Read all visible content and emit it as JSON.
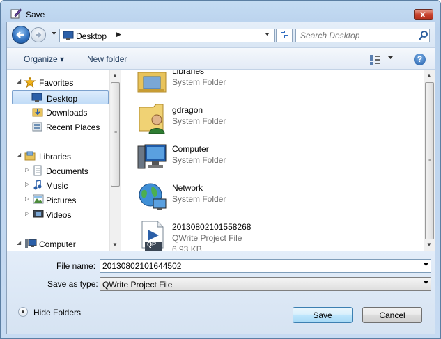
{
  "window": {
    "title": "Save",
    "close_glyph": "x"
  },
  "nav": {
    "address": "Desktop",
    "address_arrow": "▶",
    "search_placeholder": "Search Desktop"
  },
  "toolbar": {
    "organize": "Organize ▾",
    "new_folder": "New folder"
  },
  "tree": {
    "favorites": "Favorites",
    "desktop": "Desktop",
    "downloads": "Downloads",
    "recent_places": "Recent Places",
    "libraries": "Libraries",
    "documents": "Documents",
    "music": "Music",
    "pictures": "Pictures",
    "videos": "Videos",
    "computer": "Computer"
  },
  "files": [
    {
      "name": "Libraries",
      "type": "System Folder"
    },
    {
      "name": "gdragon",
      "type": "System Folder"
    },
    {
      "name": "Computer",
      "type": "System Folder"
    },
    {
      "name": "Network",
      "type": "System Folder"
    },
    {
      "name": "20130802101558268",
      "type": "QWrite Project File",
      "size": "6.93 KB",
      "badge": "QP"
    }
  ],
  "form": {
    "file_name_label": "File name:",
    "file_name_value": "20130802101644502",
    "save_type_label": "Save as type:",
    "save_type_value": "QWrite Project File"
  },
  "buttons": {
    "hide_folders": "Hide Folders",
    "save": "Save",
    "cancel": "Cancel"
  }
}
